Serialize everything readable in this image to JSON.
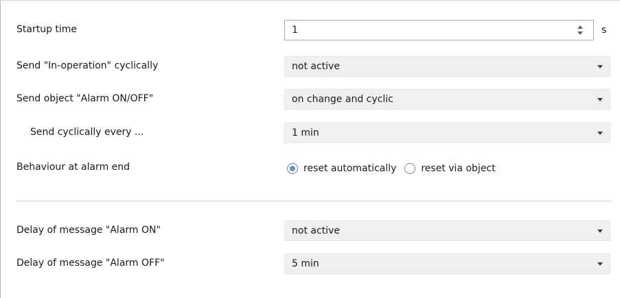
{
  "params": {
    "startup_time": {
      "label": "Startup time",
      "value": "1",
      "unit": "s"
    },
    "send_in_operation": {
      "label": "Send \"In-operation\" cyclically",
      "value": "not active"
    },
    "send_alarm": {
      "label": "Send object \"Alarm ON/OFF\"",
      "value": "on change and cyclic"
    },
    "send_cyclic": {
      "label": "Send cyclically every ...",
      "value": "1 min"
    },
    "behaviour": {
      "label": "Behaviour at alarm end",
      "options": [
        "reset automatically",
        "reset via object"
      ],
      "selected": "reset automatically"
    },
    "delay_on": {
      "label": "Delay of message \"Alarm ON\"",
      "value": "not active"
    },
    "delay_off": {
      "label": "Delay of message \"Alarm OFF\"",
      "value": "5 min"
    }
  },
  "colors": {
    "radio_accent": "#6b8fc7",
    "select_bg": "#f0f0f0"
  }
}
